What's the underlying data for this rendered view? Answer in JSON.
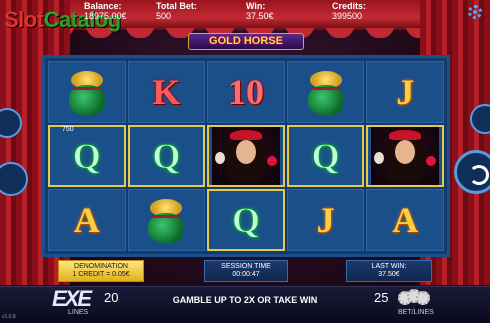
{
  "header": {
    "logo_a": "Slot",
    "logo_b": "Catalog",
    "balance_label": "Balance:",
    "balance_value": "18975.00€",
    "total_bet_label": "Total Bet:",
    "total_bet_value": "500",
    "win_label": "Win:",
    "win_value": "37.50€",
    "credits_label": "Credits:",
    "credits_value": "399500"
  },
  "game_title": "GOLD HORSE",
  "reels": [
    [
      {
        "sym": "K",
        "style": "red"
      },
      {
        "sym": "10",
        "style": "pinkred"
      },
      {
        "sym": "J",
        "style": "gold"
      }
    ],
    [
      {
        "sym": "Q",
        "style": "green",
        "win": true
      },
      {
        "sym": "Q",
        "style": "green",
        "win": true
      },
      {
        "sym": "Q",
        "style": "green",
        "win": true
      }
    ],
    [
      {
        "sym": "A",
        "style": "gold"
      },
      {
        "sym": "Q",
        "style": "green",
        "win": true
      },
      {
        "sym": "J",
        "style": "gold"
      },
      {
        "sym": "A",
        "style": "gold"
      }
    ]
  ],
  "line_win_amount": "750",
  "info": {
    "denomination_label": "DENOMINATION",
    "denomination_value": "1 CREDIT = 0.05€",
    "session_label": "SESSION TIME",
    "session_value": "00:00:47",
    "last_win_label": "LAST WIN:",
    "last_win_value": "37.50€"
  },
  "bottom": {
    "lines_logo": "EXE",
    "lines_label": "LINES",
    "lines_value": "20",
    "gamble_text": "GAMBLE UP TO 2X OR TAKE WIN",
    "bet_value": "25",
    "bet_label": "BET/LINES",
    "version": "v1.0.8"
  },
  "colors": {
    "accent": "#5a9ae0",
    "win_frame": "#e8c84a"
  }
}
